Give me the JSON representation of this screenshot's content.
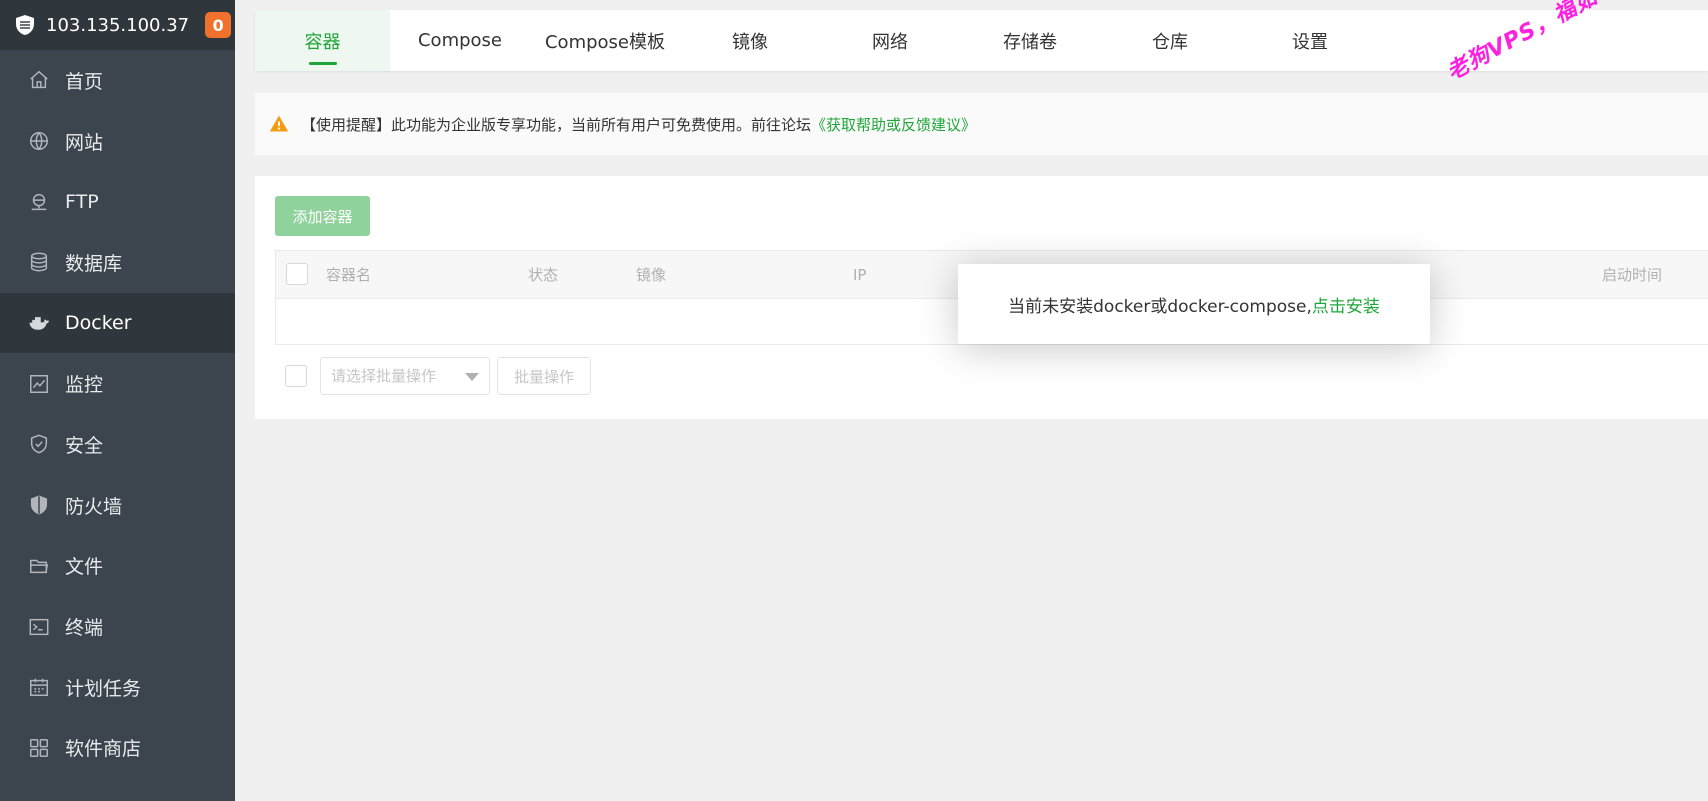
{
  "sidebar": {
    "server_ip": "103.135.100.37",
    "badge_count": "0",
    "items": [
      {
        "label": "首页",
        "icon": "home-icon"
      },
      {
        "label": "网站",
        "icon": "globe-icon"
      },
      {
        "label": "FTP",
        "icon": "ftp-icon"
      },
      {
        "label": "数据库",
        "icon": "database-icon"
      },
      {
        "label": "Docker",
        "icon": "docker-icon",
        "active": true
      },
      {
        "label": "监控",
        "icon": "monitor-icon"
      },
      {
        "label": "安全",
        "icon": "shield-icon"
      },
      {
        "label": "防火墙",
        "icon": "firewall-icon"
      },
      {
        "label": "文件",
        "icon": "folder-icon"
      },
      {
        "label": "终端",
        "icon": "terminal-icon"
      },
      {
        "label": "计划任务",
        "icon": "calendar-icon"
      },
      {
        "label": "软件商店",
        "icon": "apps-grid-icon"
      }
    ]
  },
  "tabs": [
    {
      "label": "容器",
      "active": true
    },
    {
      "label": "Compose"
    },
    {
      "label": "Compose模板"
    },
    {
      "label": "镜像"
    },
    {
      "label": "网络"
    },
    {
      "label": "存储卷"
    },
    {
      "label": "仓库"
    },
    {
      "label": "设置"
    }
  ],
  "notice": {
    "text": "【使用提醒】此功能为企业版专享功能，当前所有用户可免费使用。前往论坛",
    "link": "《获取帮助或反馈建议》"
  },
  "watermark": "老狗VPS，福如老狗！",
  "toolbar": {
    "add_label": "添加容器"
  },
  "table": {
    "columns": [
      "容器名",
      "状态",
      "镜像",
      "IP",
      "启动时间"
    ]
  },
  "batch": {
    "select_placeholder": "请选择批量操作",
    "button_label": "批量操作"
  },
  "modal": {
    "text": "当前未安装docker或docker-compose,",
    "link": "点击安装"
  },
  "colors": {
    "accent": "#20a53a",
    "sidebar_bg": "#3c444d",
    "badge": "#f0712c",
    "watermark": "#ff1fe0"
  }
}
